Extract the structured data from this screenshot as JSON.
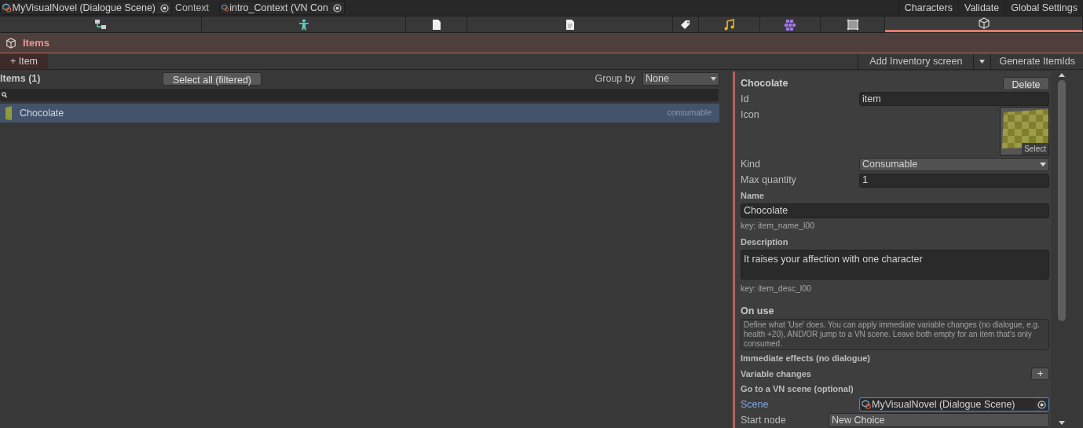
{
  "top_bar": {
    "scene_field": "MyVisualNovel (Dialogue Scene)",
    "context_label": "Context",
    "context_field": "intro_Context (VN Con",
    "buttons": [
      "Characters",
      "Validate",
      "Global Settings"
    ]
  },
  "tabs": [
    {
      "kind": "graph",
      "selected": false
    },
    {
      "kind": "character",
      "selected": false
    },
    {
      "kind": "page",
      "selected": false
    },
    {
      "kind": "document",
      "selected": false
    },
    {
      "kind": "tag",
      "selected": false
    },
    {
      "kind": "music",
      "selected": false
    },
    {
      "kind": "cluster",
      "selected": false
    },
    {
      "kind": "frame",
      "selected": false
    },
    {
      "kind": "cube",
      "selected": true
    }
  ],
  "section": {
    "title": "Items"
  },
  "toolbar": {
    "add_button": "+ Item",
    "inventory_button": "Add Inventory screen",
    "generate_button": "Generate ItemIds"
  },
  "list": {
    "title": "Items (1)",
    "select_all": "Select all (filtered)",
    "group_by_label": "Group by",
    "group_by_value": "None",
    "rows": [
      {
        "name": "Chocolate",
        "tag": "consumable",
        "selected": true
      }
    ]
  },
  "details": {
    "title": "Chocolate",
    "delete_button": "Delete",
    "id_label": "Id",
    "id_value": "item",
    "icon_label": "Icon",
    "icon_select": "Select",
    "kind_label": "Kind",
    "kind_value": "Consumable",
    "max_label": "Max quantity",
    "max_value": "1",
    "name_header": "Name",
    "name_value": "Chocolate",
    "name_key": "key: item_name_l00",
    "desc_header": "Description",
    "desc_value": "It raises your affection with one character",
    "desc_key": "key: item_desc_l00",
    "on_use_header": "On use",
    "on_use_help": "Define what 'Use' does. You can apply immediate variable changes (no dialogue, e.g. health +20), AND/OR jump to a VN scene. Leave both empty for an item that's only consumed.",
    "immediate_header": "Immediate effects (no dialogue)",
    "variable_label": "Variable changes",
    "add_button": "+",
    "goto_header": "Go to a VN scene (optional)",
    "scene_label": "Scene",
    "scene_value": "MyVisualNovel (Dialogue Scene)",
    "start_label": "Start node",
    "start_value": "New Choice"
  }
}
